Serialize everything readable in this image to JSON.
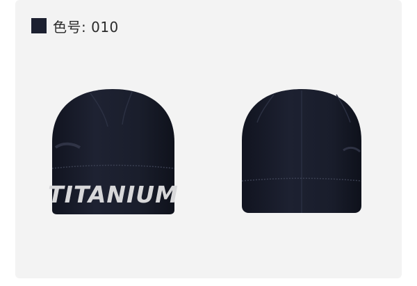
{
  "color_label": {
    "text": "色号: 010",
    "swatch_color": "#1c2030"
  },
  "products": [
    {
      "view": "front",
      "icon": "beanie-front-icon",
      "knit_text": "TITANIUM",
      "main_color": "#1a1e2c",
      "text_color": "#d8d8da"
    },
    {
      "view": "back",
      "icon": "beanie-back-icon",
      "main_color": "#1a1e2c"
    }
  ],
  "colors": {
    "page_background": "#ffffff",
    "card_background": "#f3f3f3"
  }
}
